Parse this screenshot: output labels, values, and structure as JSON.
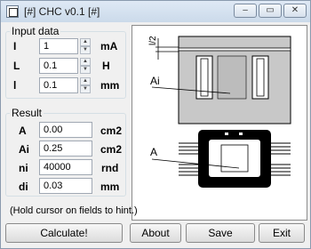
{
  "window": {
    "title": "[#] CHC v0.1 [#]",
    "controls": {
      "min": "–",
      "max": "▭",
      "close": "✕"
    }
  },
  "input": {
    "label": "Input data",
    "rows": [
      {
        "label": "I",
        "value": "1",
        "unit": "mA"
      },
      {
        "label": "L",
        "value": "0.1",
        "unit": "H"
      },
      {
        "label": "l",
        "value": "0.1",
        "unit": "mm"
      }
    ]
  },
  "result": {
    "label": "Result",
    "rows": [
      {
        "label": "A",
        "value": "0.00",
        "unit": "cm2"
      },
      {
        "label": "Ai",
        "value": "0.25",
        "unit": "cm2"
      },
      {
        "label": "ni",
        "value": "40000",
        "unit": "rnd"
      },
      {
        "label": "di",
        "value": "0.03",
        "unit": "mm"
      }
    ]
  },
  "diagram": {
    "gap_label": "l/2",
    "ai_label": "Ai",
    "a_label": "A"
  },
  "hint": "(Hold cursor on fields to hint.)",
  "buttons": {
    "calculate": "Calculate!",
    "about": "About",
    "save": "Save",
    "exit": "Exit"
  }
}
